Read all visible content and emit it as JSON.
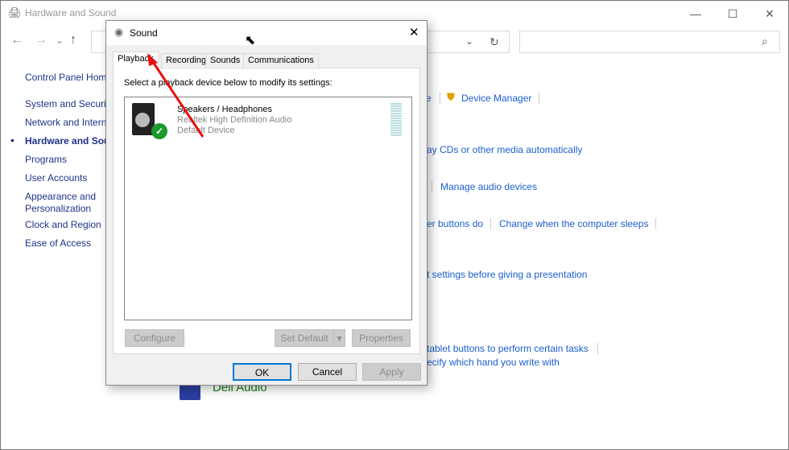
{
  "window": {
    "title": "Hardware and Sound",
    "minimize": "—",
    "maximize": "☐",
    "close": "✕",
    "search_icon": "⌕",
    "refresh_icon": "↻"
  },
  "nav": {
    "back": "←",
    "forward": "→",
    "recent": "⌄",
    "up": "↑",
    "dropdown": "⌄"
  },
  "sidebar": {
    "items": [
      {
        "label": "Control Panel Home"
      },
      {
        "label": "System and Security"
      },
      {
        "label": "Network and Internet"
      },
      {
        "label": "Hardware and Sound",
        "active": true
      },
      {
        "label": "Programs"
      },
      {
        "label": "User Accounts"
      },
      {
        "label": "Appearance and Personalization"
      },
      {
        "label": "Clock and Region"
      },
      {
        "label": "Ease of Access"
      }
    ]
  },
  "main": {
    "links": [
      {
        "label": "e"
      },
      {
        "label": "Device Manager"
      },
      {
        "label": "ay CDs or other media automatically"
      },
      {
        "label": "Manage audio devices"
      },
      {
        "label": "er buttons do"
      },
      {
        "label": "Change when the computer sleeps"
      },
      {
        "label": "t settings before giving a presentation"
      },
      {
        "label": "tablet buttons to perform certain tasks"
      },
      {
        "label": "ecify which hand you write with"
      }
    ],
    "dell_audio": "Dell Audio"
  },
  "dialog": {
    "title": "Sound",
    "close": "✕",
    "tabs": [
      {
        "label": "Playback",
        "active": true
      },
      {
        "label": "Recording"
      },
      {
        "label": "Sounds"
      },
      {
        "label": "Communications"
      }
    ],
    "instruction": "Select a playback device below to modify its settings:",
    "device": {
      "name": "Speakers / Headphones",
      "driver": "Realtek High Definition Audio",
      "status": "Default Device",
      "level": 0
    },
    "buttons": {
      "configure": "Configure",
      "set_default": "Set Default",
      "properties": "Properties",
      "ok": "OK",
      "cancel": "Cancel",
      "apply": "Apply"
    }
  },
  "colors": {
    "link": "#1a5fcc",
    "accent": "#0078d7",
    "annotation_arrow": "#e81010"
  }
}
